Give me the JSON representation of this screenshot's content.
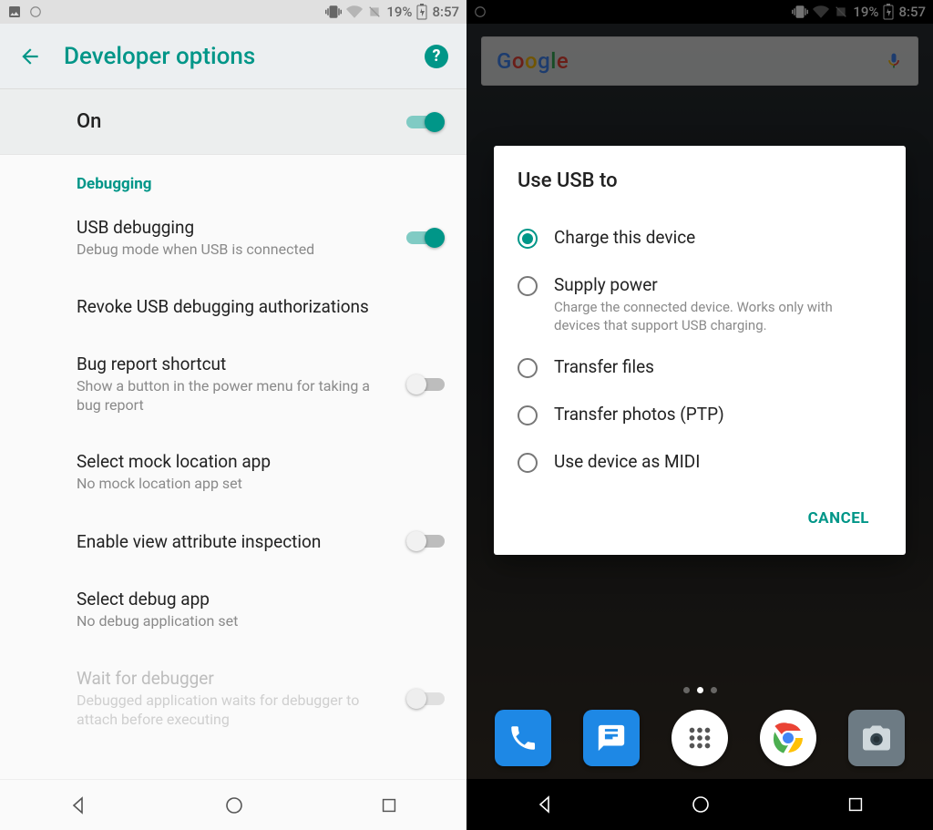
{
  "status": {
    "battery_pct": "19%",
    "time": "8:57"
  },
  "left": {
    "appbar_title": "Developer options",
    "master_toggle_label": "On",
    "section_debugging": "Debugging",
    "items": [
      {
        "title": "USB debugging",
        "subtitle": "Debug mode when USB is connected"
      },
      {
        "title": "Revoke USB debugging authorizations",
        "subtitle": ""
      },
      {
        "title": "Bug report shortcut",
        "subtitle": "Show a button in the power menu for taking a bug report"
      },
      {
        "title": "Select mock location app",
        "subtitle": "No mock location app set"
      },
      {
        "title": "Enable view attribute inspection",
        "subtitle": ""
      },
      {
        "title": "Select debug app",
        "subtitle": "No debug application set"
      },
      {
        "title": "Wait for debugger",
        "subtitle": "Debugged application waits for debugger to attach before executing"
      }
    ]
  },
  "right": {
    "search_brand": "Google",
    "dialog_title": "Use USB to",
    "options": [
      {
        "label": "Charge this device",
        "desc": ""
      },
      {
        "label": "Supply power",
        "desc": "Charge the connected device. Works only with devices that support USB charging."
      },
      {
        "label": "Transfer files",
        "desc": ""
      },
      {
        "label": "Transfer photos (PTP)",
        "desc": ""
      },
      {
        "label": "Use device as MIDI",
        "desc": ""
      }
    ],
    "cancel": "CANCEL"
  }
}
